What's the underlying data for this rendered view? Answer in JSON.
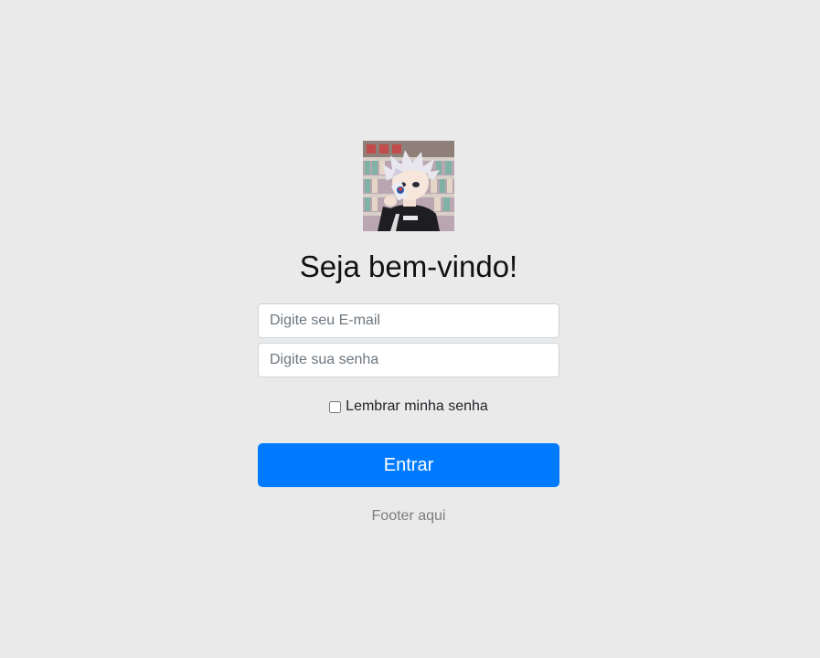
{
  "avatar": {
    "icon": "anime-character-avatar"
  },
  "heading": "Seja bem-vindo!",
  "email": {
    "placeholder": "Digite seu E-mail",
    "value": ""
  },
  "password": {
    "placeholder": "Digite sua senha",
    "value": ""
  },
  "remember": {
    "label": "Lembrar minha senha",
    "checked": false
  },
  "submit_label": "Entrar",
  "footer": "Footer aqui",
  "colors": {
    "background": "#eaeaea",
    "primary_button": "#007bff",
    "footer_text": "#7d7d7d"
  }
}
